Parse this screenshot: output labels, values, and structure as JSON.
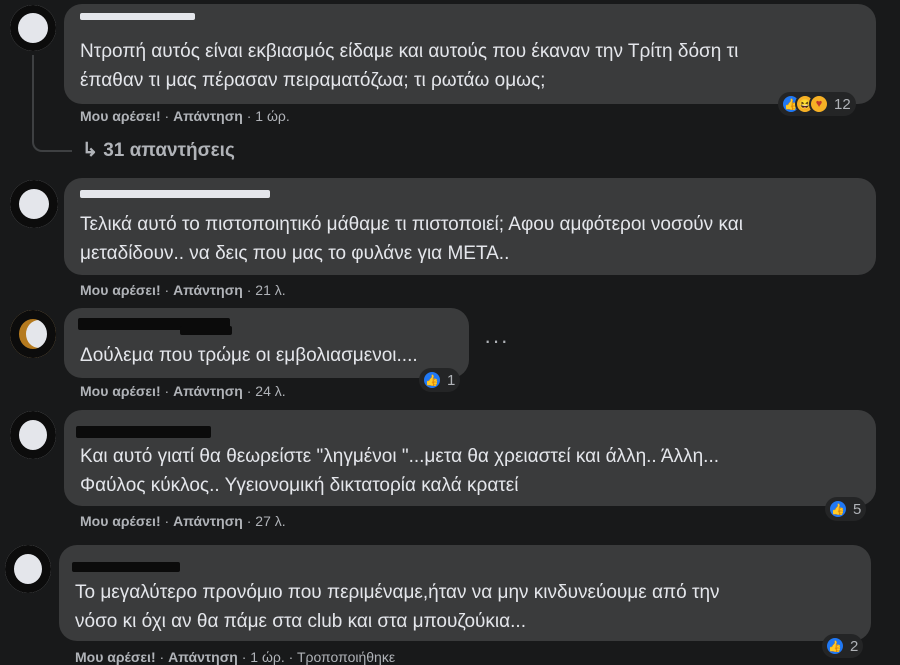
{
  "comments": [
    {
      "text_lines": [
        "Ντροπή αυτός είναι εκβιασμός είδαμε και αυτούς που έκαναν την Τρίτη δόση τι",
        "έπαθαν τι μας πέρασαν πειραματόζωα; τι ρωτάω ομως;"
      ],
      "like_label": "Μου αρέσει!",
      "reply_label": "Απάντηση",
      "time": "1 ώρ.",
      "reaction_count": "12",
      "reactions": [
        "like-icon",
        "haha-icon",
        "care-icon"
      ]
    },
    {
      "text_lines": [
        "Τελικά αυτό το πιστοποιητικό μάθαμε τι πιστοποιεί; Αφου αμφότεροι νοσούν και",
        "μεταδίδουν.. να δεις που μας το φυλάνε για ΜΕΤΑ.."
      ],
      "like_label": "Μου αρέσει!",
      "reply_label": "Απάντηση",
      "time": "21 λ."
    },
    {
      "text_lines": [
        "Δούλεμα που τρώμε οι εμβολιασμενοι...."
      ],
      "like_label": "Μου αρέσει!",
      "reply_label": "Απάντηση",
      "time": "24 λ.",
      "reaction_count": "1",
      "more_label": "···"
    },
    {
      "text_lines": [
        "Και αυτό γιατί θα θεωρείστε \"ληγμένοι \"...μετα θα χρειαστεί και άλλη.. Άλλη...",
        "Φαύλος κύκλος.. Υγειονομική δικτατορία καλά κρατεί"
      ],
      "like_label": "Μου αρέσει!",
      "reply_label": "Απάντηση",
      "time": "27 λ.",
      "reaction_count": "5"
    },
    {
      "text_lines": [
        "Το μεγαλύτερο προνόμιο που περιμέναμε,ήταν να μην κινδυνεύουμε από την",
        "νόσο κι όχι αν θα πάμε στα club και στα μπουζούκια..."
      ],
      "like_label": "Μου αρέσει!",
      "reply_label": "Απάντηση",
      "time": "1 ώρ.",
      "edited": "Τροποποιήθηκε",
      "reaction_count": "2"
    }
  ],
  "replies_link": {
    "arrow": "↳",
    "label": "31 απαντήσεις"
  },
  "colors": {
    "background": "#18191a",
    "bubble": "#3a3b3c",
    "text": "#e4e6eb",
    "muted": "#b0b3b8",
    "like": "#2078f4"
  }
}
